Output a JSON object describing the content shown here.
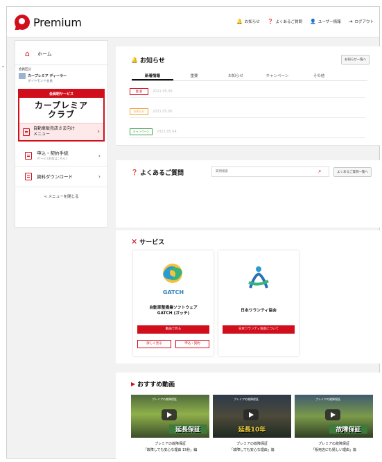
{
  "header": {
    "logo_text": "Premium",
    "nav": [
      {
        "label": "お知らせ",
        "icon": "bell-icon",
        "glyph": "🔔"
      },
      {
        "label": "よくあるご質問",
        "icon": "question-icon",
        "glyph": "❓"
      },
      {
        "label": "ユーザー情報",
        "icon": "user-icon",
        "glyph": "👤"
      },
      {
        "label": "ログアウト",
        "icon": "logout-icon",
        "glyph": "⇥"
      }
    ]
  },
  "sidebar": {
    "home_label": "ホーム",
    "member": {
      "label": "会員区分",
      "name": "カープレミア ディーラー",
      "rank": "ダイヤモンド会員"
    },
    "member_service": {
      "heading": "会員制サービス",
      "club_line1": "カープレミア",
      "club_line2": "クラブ",
      "dealer_menu_line1": "自動車販売店さま向け",
      "dealer_menu_line2": "メニュー"
    },
    "items": [
      {
        "label": "申込・契約手続",
        "sub": "(サービス利用はこちら)"
      },
      {
        "label": "資料ダウンロード",
        "sub": ""
      }
    ],
    "close_label": "< メニューを閉じる"
  },
  "news": {
    "title": "お知らせ",
    "list_button": "お知らせ一覧へ",
    "tabs": [
      "新着情報",
      "重要",
      "お知らせ",
      "キャンペーン",
      "その他"
    ],
    "active_tab": "新着情報",
    "rows": [
      {
        "tag": "重 要",
        "date": "2021.05.06",
        "color": "#d10f1c"
      },
      {
        "tag": "お知らせ",
        "date": "2021.05.06",
        "color": "#f0a23a"
      },
      {
        "tag": "キャンペーン",
        "date": "2021.05.04",
        "color": "#3aa24a"
      }
    ]
  },
  "faq": {
    "title": "よくあるご質問",
    "search_placeholder": "質問検索",
    "list_button": "よくあるご質問一覧へ"
  },
  "services": {
    "title": "サービス",
    "cards": [
      {
        "logo_text": "GATCH",
        "name_line1": "自動車整備業ソフトウェア",
        "name_line2": "GATCH (ガッチ)",
        "primary_button": "動画で見る",
        "secondary_buttons": [
          "詳しく見る",
          "申込・契約"
        ]
      },
      {
        "logo_text": "",
        "name_line1": "日本ワランティ協会",
        "name_line2": "",
        "primary_button": "日本ワランティ協会について",
        "secondary_buttons": []
      }
    ]
  },
  "videos": {
    "title": "おすすめ動画",
    "items": [
      {
        "thumb_text": "延長保証",
        "caption_line1": "プレミアの故障保証",
        "caption_line2": "「故障しても安心な理由 15秒」編"
      },
      {
        "thumb_text": "延長10年",
        "caption_line1": "プレミアの故障保証",
        "caption_line2": "「故障しても安心な理由」篇"
      },
      {
        "thumb_text": "故障保証",
        "caption_line1": "プレミアの故障保証",
        "caption_line2": "「販売店にも嬉しい理由」篇"
      }
    ]
  },
  "colors": {
    "brand_red": "#d10f1c",
    "background": "#f2f2f2"
  }
}
